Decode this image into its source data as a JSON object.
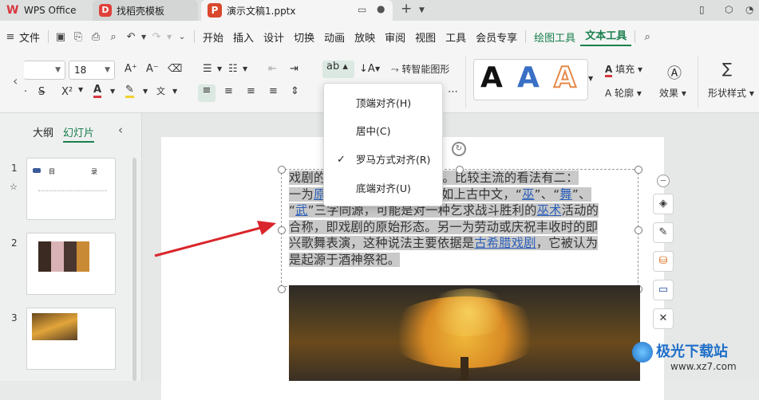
{
  "titlebar": {
    "tabs": [
      {
        "label": "WPS Office"
      },
      {
        "label": "找稻壳模板"
      },
      {
        "label": "演示文稿1.pptx"
      }
    ],
    "new_tab": "+"
  },
  "menu": {
    "file_label": "文件",
    "items": [
      "开始",
      "插入",
      "设计",
      "切换",
      "动画",
      "放映",
      "审阅",
      "视图",
      "工具",
      "会员专享"
    ],
    "drawing_tools": "绘图工具",
    "text_tools": "文本工具"
  },
  "ribbon": {
    "font_size": "18",
    "convert_smart": "转智能图形",
    "fill_label": "填充",
    "outline_label": "轮廓",
    "effects_label": "效果",
    "shape_style_label": "形状样式",
    "wordart_sample": "A"
  },
  "sidebar": {
    "tab_outline": "大纲",
    "tab_slides": "幻灯片",
    "slides": [
      {
        "num": "1",
        "title": "目",
        "title2": "录"
      },
      {
        "num": "2"
      },
      {
        "num": "3"
      }
    ]
  },
  "slide_text": {
    "s1": "戏剧的",
    "s2": "多种假说。比较主流的看法有二：",
    "s3": "一为",
    "s4": "原",
    "s5": "比如上古中文，“",
    "s6": "巫",
    "s7": "”、“",
    "s8": "舞",
    "s9": "”、",
    "s10": "“",
    "s11": "武",
    "s12": "”三字同源，可能是对一种乞求战斗胜利的",
    "s13": "巫术",
    "s14": "活动的",
    "s15": "合称，即戏剧的原始形态。另一为劳动或庆祝丰收时的即",
    "s16": "兴歌舞表演，这种说法主要依据是",
    "s17": "古希腊戏剧",
    "s18": "，它被认为",
    "s19": "是起源于酒神祭祀。"
  },
  "dropdown": {
    "items": [
      {
        "label": "顶端对齐(H)",
        "checked": false
      },
      {
        "label": "居中(C)",
        "checked": false
      },
      {
        "label": "罗马方式对齐(R)",
        "checked": true
      },
      {
        "label": "底端对齐(U)",
        "checked": false
      }
    ],
    "check_mark": "✓"
  },
  "watermark": {
    "name": "极光下载站",
    "url": "www.xz7.com"
  },
  "colors": {
    "accent": "#1a7f4e",
    "font_color": "#d9363e",
    "highlight": "#f2d22e",
    "link": "#2b5fb8",
    "arrow": "#d9262c"
  }
}
